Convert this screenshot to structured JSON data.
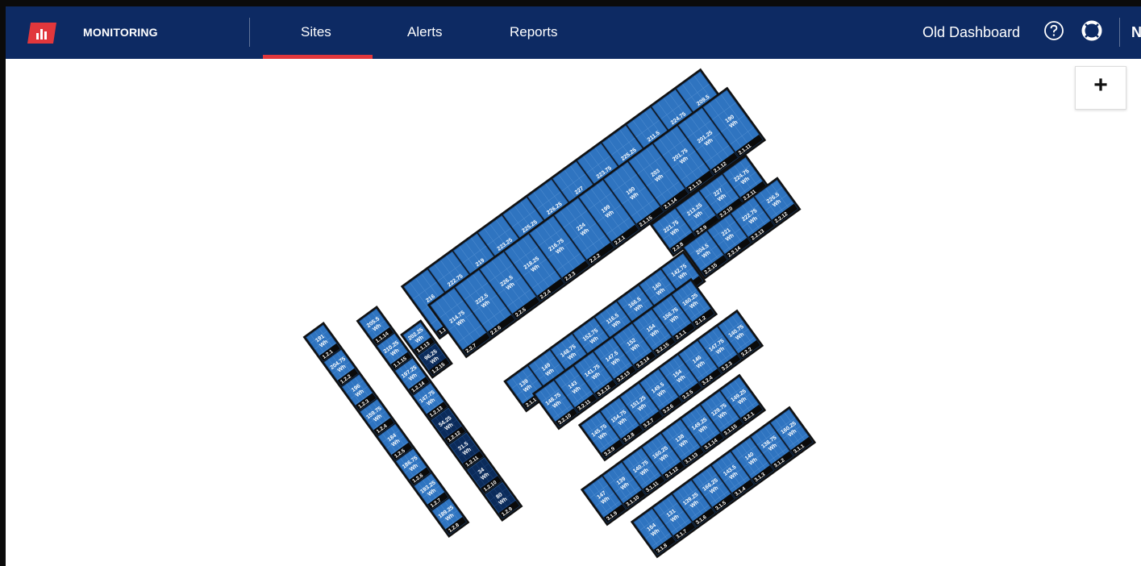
{
  "app": {
    "brand": "MONITORING"
  },
  "nav": {
    "tabs": [
      {
        "label": "Sites",
        "active": true
      },
      {
        "label": "Alerts"
      },
      {
        "label": "Reports"
      }
    ]
  },
  "header_right": {
    "old_dashboard": "Old Dashboard",
    "help_icon": "help-circle-icon",
    "support_icon": "lifebuoy-icon",
    "clipped_label": "N"
  },
  "map": {
    "zoom_in_label": "+"
  },
  "colors": {
    "topbar": "#0d2a63",
    "accent": "#e1373c",
    "panel": "#2f74c0",
    "panel_dark": "#0b2b5a",
    "panel_label_bg": "#0a0a0a"
  },
  "arrays": [
    {
      "name": "row-1",
      "panels": [
        {
          "id": "1.1.1",
          "wh": "216 Wh"
        },
        {
          "id": "1.1.2",
          "wh": "222.75 Wh"
        },
        {
          "id": "1.1.3",
          "wh": "219 Wh"
        },
        {
          "id": "1.1.4",
          "wh": "223.25 Wh"
        },
        {
          "id": "1.1.5",
          "wh": "225.25 Wh"
        },
        {
          "id": "1.1.6",
          "wh": "226.25 Wh"
        },
        {
          "id": "1.1.7",
          "wh": "227 Wh"
        },
        {
          "id": "1.1.8",
          "wh": "223.75 Wh"
        },
        {
          "id": "1.1.9",
          "wh": "225.25 Wh"
        },
        {
          "id": "1.1.10",
          "wh": "211.5 Wh"
        },
        {
          "id": "1.1.11",
          "wh": "224.75 Wh"
        },
        {
          "id": "1.1.12",
          "wh": "209.5 Wh"
        }
      ]
    },
    {
      "name": "row-2",
      "panels": [
        {
          "id": "2.2.7",
          "wh": "214.75 Wh"
        },
        {
          "id": "2.2.6",
          "wh": "222.5 Wh"
        },
        {
          "id": "2.2.5",
          "wh": "226.5 Wh"
        },
        {
          "id": "2.2.4",
          "wh": "218.25 Wh"
        },
        {
          "id": "2.2.3",
          "wh": "216.75 Wh"
        },
        {
          "id": "2.2.2",
          "wh": "224 Wh"
        },
        {
          "id": "2.2.1",
          "wh": "199 Wh"
        },
        {
          "id": "2.1.15",
          "wh": "190 Wh"
        },
        {
          "id": "2.1.14",
          "wh": "203 Wh"
        },
        {
          "id": "2.1.13",
          "wh": "201.75 Wh"
        },
        {
          "id": "2.1.12",
          "wh": "201.25 Wh"
        },
        {
          "id": "2.1.11",
          "wh": "190 Wh"
        }
      ]
    },
    {
      "name": "array-2-top-a",
      "panels": [
        {
          "id": "2.2.8",
          "wh": "221.75 Wh"
        },
        {
          "id": "2.2.9",
          "wh": "213.25 Wh"
        },
        {
          "id": "2.2.10",
          "wh": "227 Wh"
        },
        {
          "id": "2.2.11",
          "wh": "224.75 Wh"
        }
      ]
    },
    {
      "name": "array-2-top-b",
      "panels": [
        {
          "id": "2.2.15",
          "wh": "204.5 Wh"
        },
        {
          "id": "2.2.14",
          "wh": "221 Wh"
        },
        {
          "id": "2.2.13",
          "wh": "222.75 Wh"
        },
        {
          "id": "2.2.12",
          "wh": "226.5 Wh"
        }
      ]
    },
    {
      "name": "array-2-mid",
      "panels": [
        {
          "id": "2.1.10",
          "wh": "139 Wh"
        },
        {
          "id": "2.1.9",
          "wh": "149 Wh"
        },
        {
          "id": "2.1.8",
          "wh": "148.75 Wh"
        },
        {
          "id": "2.1.7",
          "wh": "152.75 Wh"
        },
        {
          "id": "2.1.6",
          "wh": "116.5 Wh"
        },
        {
          "id": "2.1.5",
          "wh": "166.5 Wh"
        },
        {
          "id": "2.1.4",
          "wh": "140 Wh"
        },
        {
          "id": "2.1.3",
          "wh": "142.75 Wh"
        }
      ]
    },
    {
      "name": "array-3-a",
      "panels": [
        {
          "id": "3.2.10",
          "wh": "148.75 Wh"
        },
        {
          "id": "3.2.11",
          "wh": "143 Wh"
        },
        {
          "id": "3.2.12",
          "wh": "141.75 Wh"
        },
        {
          "id": "3.2.13",
          "wh": "147.5 Wh"
        },
        {
          "id": "3.2.14",
          "wh": "152 Wh"
        },
        {
          "id": "3.2.15",
          "wh": "154 Wh"
        },
        {
          "id": "2.1.1",
          "wh": "156.75 Wh"
        },
        {
          "id": "2.1.2",
          "wh": "160.25 Wh"
        }
      ]
    },
    {
      "name": "array-3-b",
      "panels": [
        {
          "id": "3.2.9",
          "wh": "145.75 Wh"
        },
        {
          "id": "3.2.8",
          "wh": "154.75 Wh"
        },
        {
          "id": "3.2.7",
          "wh": "151.25 Wh"
        },
        {
          "id": "3.2.6",
          "wh": "149.5 Wh"
        },
        {
          "id": "3.2.5",
          "wh": "154 Wh"
        },
        {
          "id": "3.2.4",
          "wh": "146 Wh"
        },
        {
          "id": "3.2.3",
          "wh": "147.75 Wh"
        },
        {
          "id": "3.2.2",
          "wh": "140.75 Wh"
        }
      ]
    },
    {
      "name": "array-3-c",
      "panels": [
        {
          "id": "3.1.9",
          "wh": "147 Wh"
        },
        {
          "id": "3.1.10",
          "wh": "139 Wh"
        },
        {
          "id": "3.1.11",
          "wh": "140.75 Wh"
        },
        {
          "id": "3.1.12",
          "wh": "160.25 Wh"
        },
        {
          "id": "3.1.13",
          "wh": "138 Wh"
        },
        {
          "id": "3.1.14",
          "wh": "149.25 Wh"
        },
        {
          "id": "3.1.15",
          "wh": "129.75 Wh"
        },
        {
          "id": "3.2.1",
          "wh": "149.25 Wh"
        }
      ]
    },
    {
      "name": "array-3-d",
      "panels": [
        {
          "id": "3.1.8",
          "wh": "154 Wh"
        },
        {
          "id": "3.1.7",
          "wh": "131 Wh"
        },
        {
          "id": "3.1.6",
          "wh": "139.25 Wh"
        },
        {
          "id": "3.1.5",
          "wh": "166.25 Wh"
        },
        {
          "id": "3.1.4",
          "wh": "143.5 Wh"
        },
        {
          "id": "3.1.3",
          "wh": "140 Wh"
        },
        {
          "id": "3.1.2",
          "wh": "138.75 Wh"
        },
        {
          "id": "3.1.1",
          "wh": "160.25 Wh"
        }
      ]
    },
    {
      "name": "array-1-a",
      "panels": [
        {
          "id": "1.2.1",
          "wh": "191 Wh"
        },
        {
          "id": "1.2.2",
          "wh": "204.75 Wh"
        },
        {
          "id": "1.2.3",
          "wh": "196 Wh"
        },
        {
          "id": "1.2.4",
          "wh": "159.75 Wh"
        },
        {
          "id": "1.2.5",
          "wh": "184 Wh"
        },
        {
          "id": "1.2.6",
          "wh": "186.75 Wh"
        },
        {
          "id": "1.2.7",
          "wh": "193.25 Wh"
        },
        {
          "id": "1.2.8",
          "wh": "189.25 Wh"
        }
      ]
    },
    {
      "name": "array-1-b",
      "panels": [
        {
          "id": "1.1.14",
          "wh": "205.5 Wh"
        },
        {
          "id": "1.1.15",
          "wh": "210.25 Wh"
        },
        {
          "id": "1.2.14",
          "wh": "197.25 Wh"
        },
        {
          "id": "1.2.13",
          "wh": "147.75 Wh"
        },
        {
          "id": "1.2.12",
          "wh": "54.25 Wh"
        },
        {
          "id": "1.2.11",
          "wh": "31.5 Wh"
        },
        {
          "id": "1.2.10",
          "wh": "34 Wh"
        },
        {
          "id": "1.2.9",
          "wh": "80 Wh"
        }
      ]
    },
    {
      "name": "array-1-c",
      "panels": [
        {
          "id": "1.1.13",
          "wh": "202.25 Wh"
        },
        {
          "id": "1.2.15",
          "wh": "96.25 Wh"
        }
      ]
    }
  ]
}
